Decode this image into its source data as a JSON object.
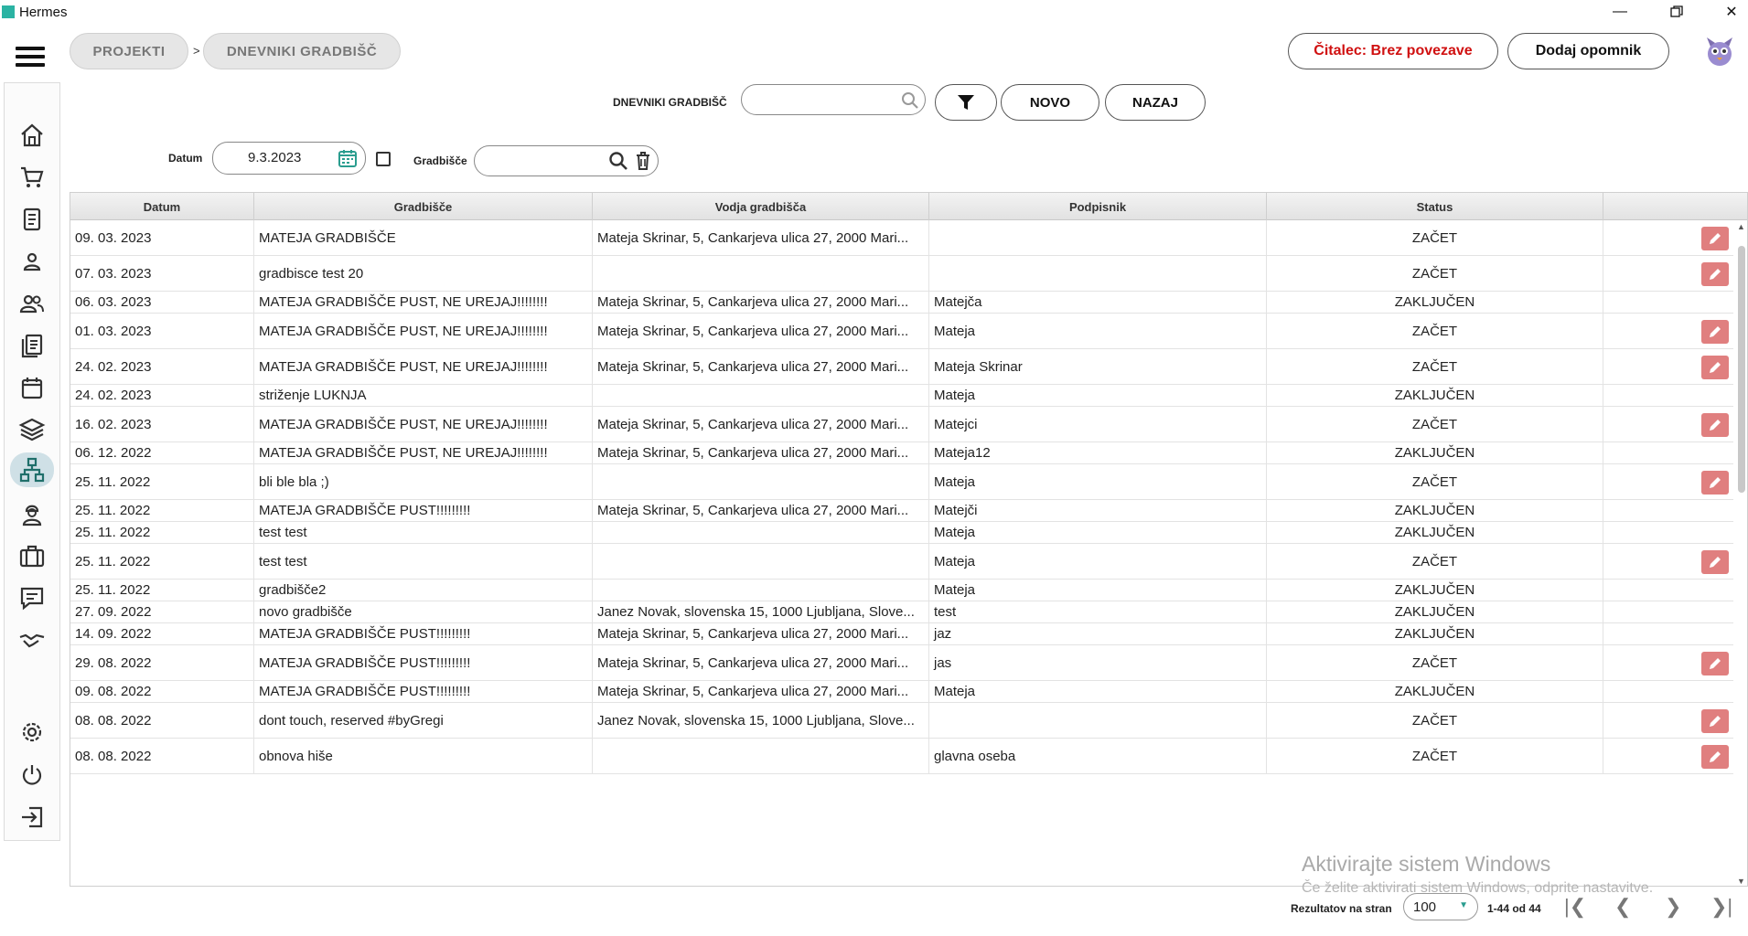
{
  "window": {
    "title": "Hermes"
  },
  "breadcrumb": [
    {
      "label": "PROJEKTI"
    },
    {
      "label": "DNEVNIKI GRADBIŠČ"
    }
  ],
  "breadcrumb_separator": ">",
  "header": {
    "reader_status": "Čitalec: Brez povezave",
    "add_reminder": "Dodaj opomnik"
  },
  "search": {
    "label": "DNEVNIKI GRADBIŠČ",
    "value": "",
    "new_button": "NOVO",
    "back_button": "NAZAJ"
  },
  "filters": {
    "date_label": "Datum",
    "date_value": "9.3.2023",
    "site_label": "Gradbišče",
    "site_value": ""
  },
  "table": {
    "columns": [
      "Datum",
      "Gradbišče",
      "Vodja gradbišča",
      "Podpisnik",
      "Status"
    ],
    "rows": [
      {
        "date": "09. 03. 2023",
        "site": "MATEJA GRADBIŠČE",
        "manager": "Mateja Skrinar, 5, Cankarjeva ulica 27, 2000 Mari...",
        "signer": "",
        "status": "ZAČET",
        "editable": true
      },
      {
        "date": "07. 03. 2023",
        "site": "gradbisce test 20",
        "manager": "",
        "signer": "",
        "status": "ZAČET",
        "editable": true
      },
      {
        "date": "06. 03. 2023",
        "site": "MATEJA GRADBIŠČE PUST, NE UREJAJ!!!!!!!!",
        "manager": "Mateja Skrinar, 5, Cankarjeva ulica 27, 2000 Mari...",
        "signer": "Matejča",
        "status": "ZAKLJUČEN",
        "editable": false
      },
      {
        "date": "01. 03. 2023",
        "site": "MATEJA GRADBIŠČE PUST, NE UREJAJ!!!!!!!!",
        "manager": "Mateja Skrinar, 5, Cankarjeva ulica 27, 2000 Mari...",
        "signer": "Mateja",
        "status": "ZAČET",
        "editable": true
      },
      {
        "date": "24. 02. 2023",
        "site": "MATEJA GRADBIŠČE PUST, NE UREJAJ!!!!!!!!",
        "manager": "Mateja Skrinar, 5, Cankarjeva ulica 27, 2000 Mari...",
        "signer": "Mateja Skrinar",
        "status": "ZAČET",
        "editable": true
      },
      {
        "date": "24. 02. 2023",
        "site": "striženje LUKNJA",
        "manager": "",
        "signer": "Mateja",
        "status": "ZAKLJUČEN",
        "editable": false
      },
      {
        "date": "16. 02. 2023",
        "site": "MATEJA GRADBIŠČE PUST, NE UREJAJ!!!!!!!!",
        "manager": "Mateja Skrinar, 5, Cankarjeva ulica 27, 2000 Mari...",
        "signer": "Matejci",
        "status": "ZAČET",
        "editable": true
      },
      {
        "date": "06. 12. 2022",
        "site": "MATEJA GRADBIŠČE PUST, NE UREJAJ!!!!!!!!",
        "manager": "Mateja Skrinar, 5, Cankarjeva ulica 27, 2000 Mari...",
        "signer": "Mateja12",
        "status": "ZAKLJUČEN",
        "editable": false
      },
      {
        "date": "25. 11. 2022",
        "site": "bli ble bla ;)",
        "manager": "",
        "signer": "Mateja",
        "status": "ZAČET",
        "editable": true
      },
      {
        "date": "25. 11. 2022",
        "site": "MATEJA GRADBIŠČE PUST!!!!!!!!!",
        "manager": "Mateja Skrinar, 5, Cankarjeva ulica 27, 2000 Mari...",
        "signer": "Matejči",
        "status": "ZAKLJUČEN",
        "editable": false
      },
      {
        "date": "25. 11. 2022",
        "site": "test test",
        "manager": "",
        "signer": "Mateja",
        "status": "ZAKLJUČEN",
        "editable": false
      },
      {
        "date": "25. 11. 2022",
        "site": "test test",
        "manager": "",
        "signer": "Mateja",
        "status": "ZAČET",
        "editable": true
      },
      {
        "date": "25. 11. 2022",
        "site": "gradbišče2",
        "manager": "",
        "signer": "Mateja",
        "status": "ZAKLJUČEN",
        "editable": false
      },
      {
        "date": "27. 09. 2022",
        "site": "novo gradbišče",
        "manager": "Janez Novak, slovenska 15, 1000 Ljubljana, Slove...",
        "signer": "test",
        "status": "ZAKLJUČEN",
        "editable": false
      },
      {
        "date": "14. 09. 2022",
        "site": "MATEJA GRADBIŠČE PUST!!!!!!!!!",
        "manager": "Mateja Skrinar, 5, Cankarjeva ulica 27, 2000 Mari...",
        "signer": "jaz",
        "status": "ZAKLJUČEN",
        "editable": false
      },
      {
        "date": "29. 08. 2022",
        "site": "MATEJA GRADBIŠČE PUST!!!!!!!!!",
        "manager": "Mateja Skrinar, 5, Cankarjeva ulica 27, 2000 Mari...",
        "signer": "jas",
        "status": "ZAČET",
        "editable": true
      },
      {
        "date": "09. 08. 2022",
        "site": "MATEJA GRADBIŠČE PUST!!!!!!!!!",
        "manager": "Mateja Skrinar, 5, Cankarjeva ulica 27, 2000 Mari...",
        "signer": "Mateja",
        "status": "ZAKLJUČEN",
        "editable": false
      },
      {
        "date": "08. 08. 2022",
        "site": "dont touch, reserved #byGregi",
        "manager": "Janez Novak, slovenska 15, 1000 Ljubljana, Slove...",
        "signer": "",
        "status": "ZAČET",
        "editable": true
      },
      {
        "date": "08. 08. 2022",
        "site": "obnova hiše",
        "manager": "",
        "signer": "glavna oseba",
        "status": "ZAČET",
        "editable": true
      }
    ]
  },
  "pagination": {
    "per_page_label": "Rezultatov na stran",
    "per_page_value": "100",
    "range": "1-44 od 44"
  },
  "watermark": {
    "line1": "Aktivirajte sistem Windows",
    "line2": "Če želite aktivirati sistem Windows, odprite nastavitve."
  },
  "colors": {
    "accent": "#2a9d8f",
    "edit": "#e07f7f",
    "status_red": "#d01010"
  }
}
